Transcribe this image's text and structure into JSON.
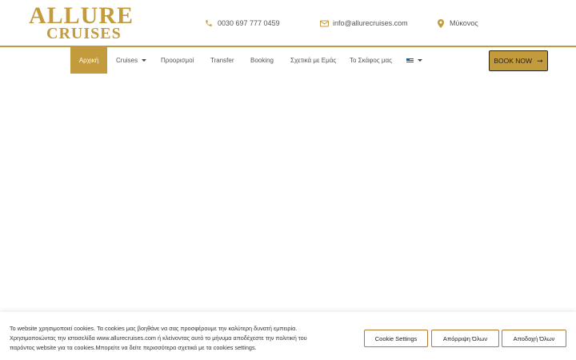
{
  "header": {
    "logo": {
      "line1": "ALLURE",
      "line2": "CRUISES"
    },
    "phone": {
      "icon": "phone-icon",
      "text": "0030 697 777 0459"
    },
    "email": {
      "icon": "envelope-icon",
      "text": "info@allurecruises.com"
    },
    "location": {
      "icon": "map-pin-icon",
      "text": "Μύκονος"
    }
  },
  "nav": {
    "items": [
      {
        "label": "Αρχική",
        "active": true
      },
      {
        "label": "Cruises",
        "has_dropdown": true
      },
      {
        "label": "Προορισμοί"
      },
      {
        "label": "Transfer"
      },
      {
        "label": "Booking"
      },
      {
        "label": "Σχετικά με Εμάς"
      },
      {
        "label": "Το Σκάφος μας"
      }
    ],
    "language": {
      "icon": "greek-flag-icon",
      "has_dropdown": true
    },
    "book_button": {
      "label": "BOOK NOW",
      "icon": "arrow-right-icon"
    }
  },
  "cookie_banner": {
    "text_line1": "Το website χρησιμοποιεί cookies. Τα cookies μας βοηθάνε να σας προσφέρουμε την καλύτερη δυνατή εμπειρία.",
    "text_line2": "Χρησιμοποιώντας την ιστοσελίδα www.allurecruises.com ή κλείνοντας αυτό το μήνυμα αποδέχεστε την πολιτική του",
    "text_line3": "παρόντος website για τα cookies.Μπορείτε να δείτε περισσότερα σχετικά με τα cookies settings.",
    "settings_label": "Cookie Settings",
    "reject_label": "Απόρριψη Όλων",
    "accept_label": "Αποδοχή Όλων"
  },
  "colors": {
    "accent": "#c39a3c",
    "button_border": "#b07a30"
  }
}
